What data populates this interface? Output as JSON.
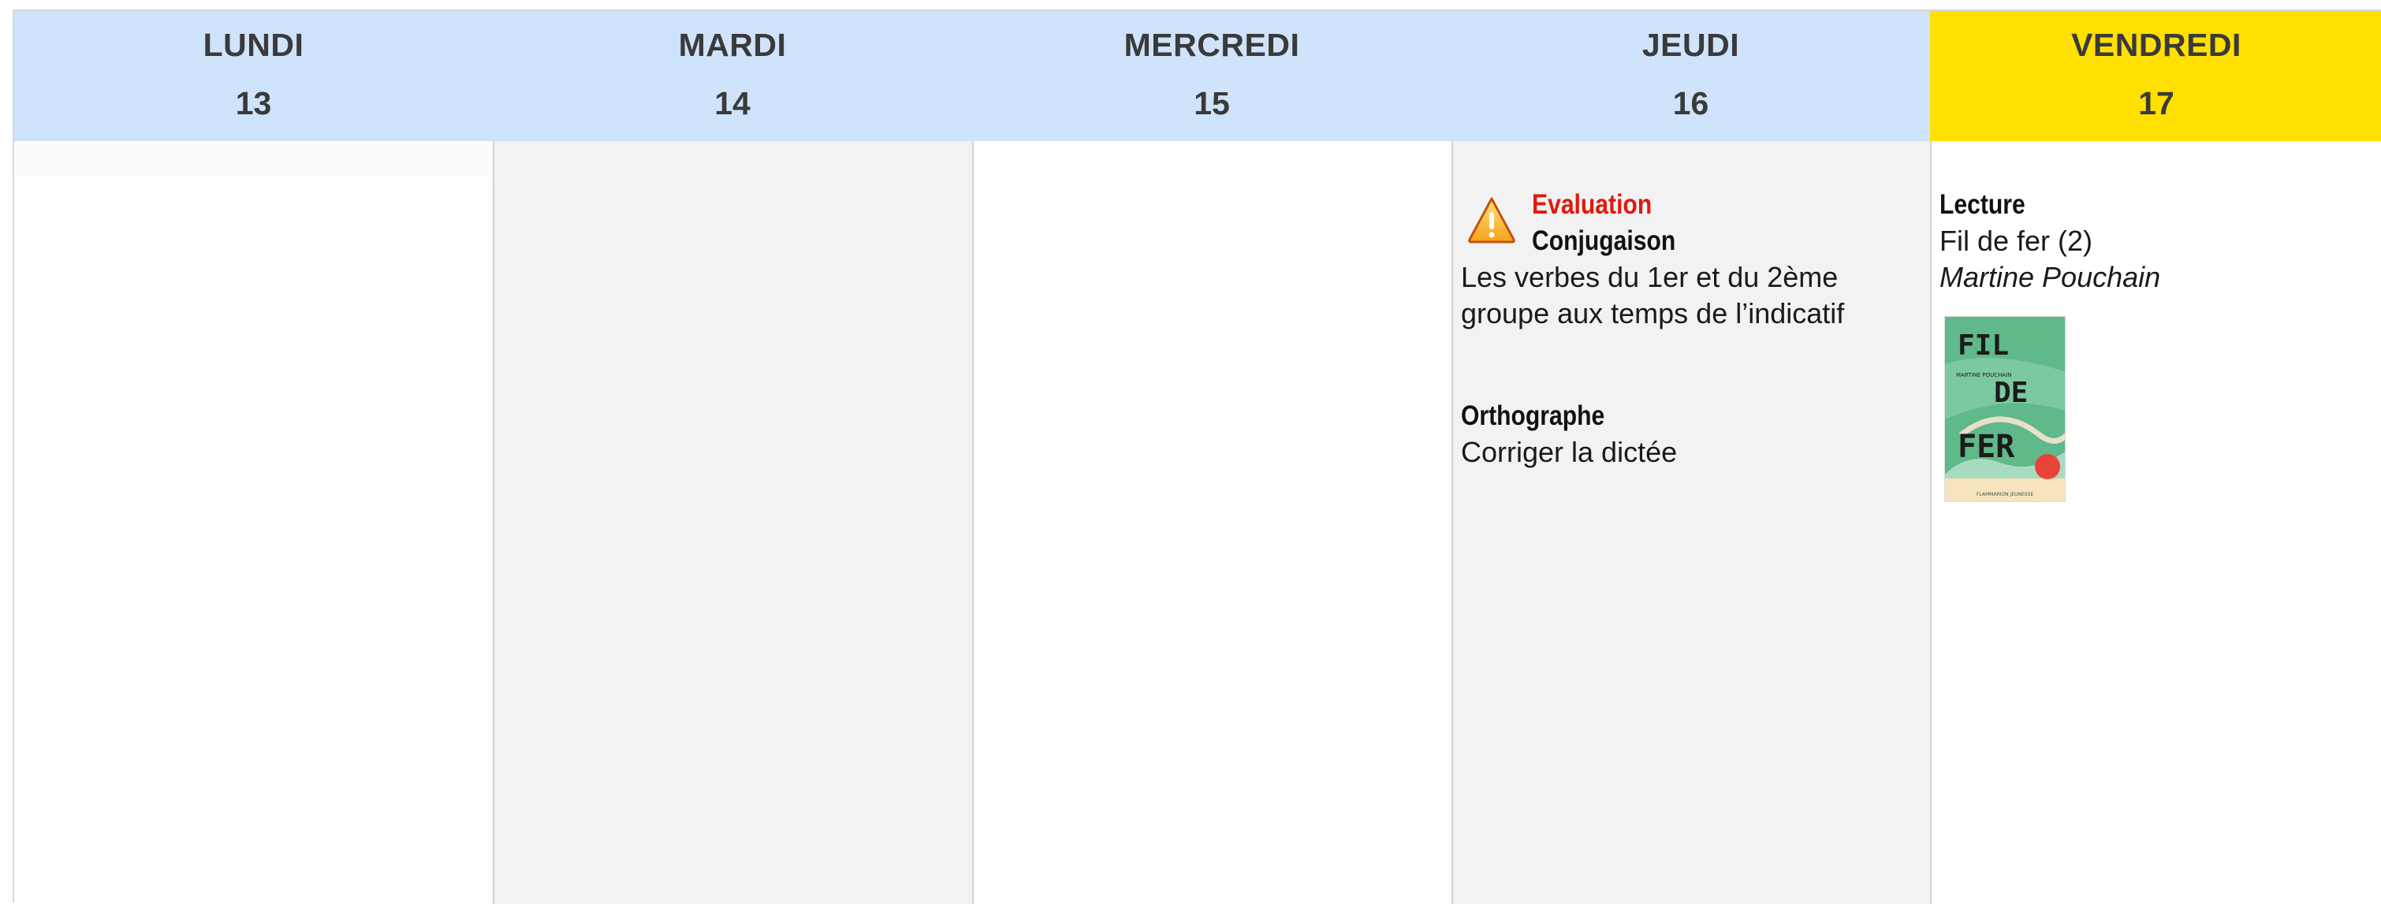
{
  "days": [
    {
      "name": "LUNDI",
      "number": "13"
    },
    {
      "name": "MARDI",
      "number": "14"
    },
    {
      "name": "MERCREDI",
      "number": "15"
    },
    {
      "name": "JEUDI",
      "number": "16"
    },
    {
      "name": "VENDREDI",
      "number": "17"
    }
  ],
  "colors": {
    "header_bg": "#cfe3fb",
    "current_day_bg": "#ffe000",
    "evaluation_red": "#e3180c",
    "empty_day_bg": "#f2f2f2"
  },
  "jeudi": {
    "evaluation": {
      "icon": "warning-icon",
      "label": "Evaluation",
      "subject": "Conjugaison",
      "description": "Les verbes du 1er et du 2ème groupe aux temps de l’indicatif"
    },
    "orthographe": {
      "subject": "Orthographe",
      "description": "Corriger la dictée"
    }
  },
  "vendredi": {
    "lecture": {
      "subject": "Lecture",
      "title": "Fil de fer (2)",
      "author": "Martine Pouchain",
      "cover": {
        "title_line1": "FIL",
        "title_line2": "DE",
        "title_line3": "FER",
        "author": "MARTINE POUCHAIN",
        "publisher": "FLAMMARION JEUNESSE"
      }
    }
  }
}
